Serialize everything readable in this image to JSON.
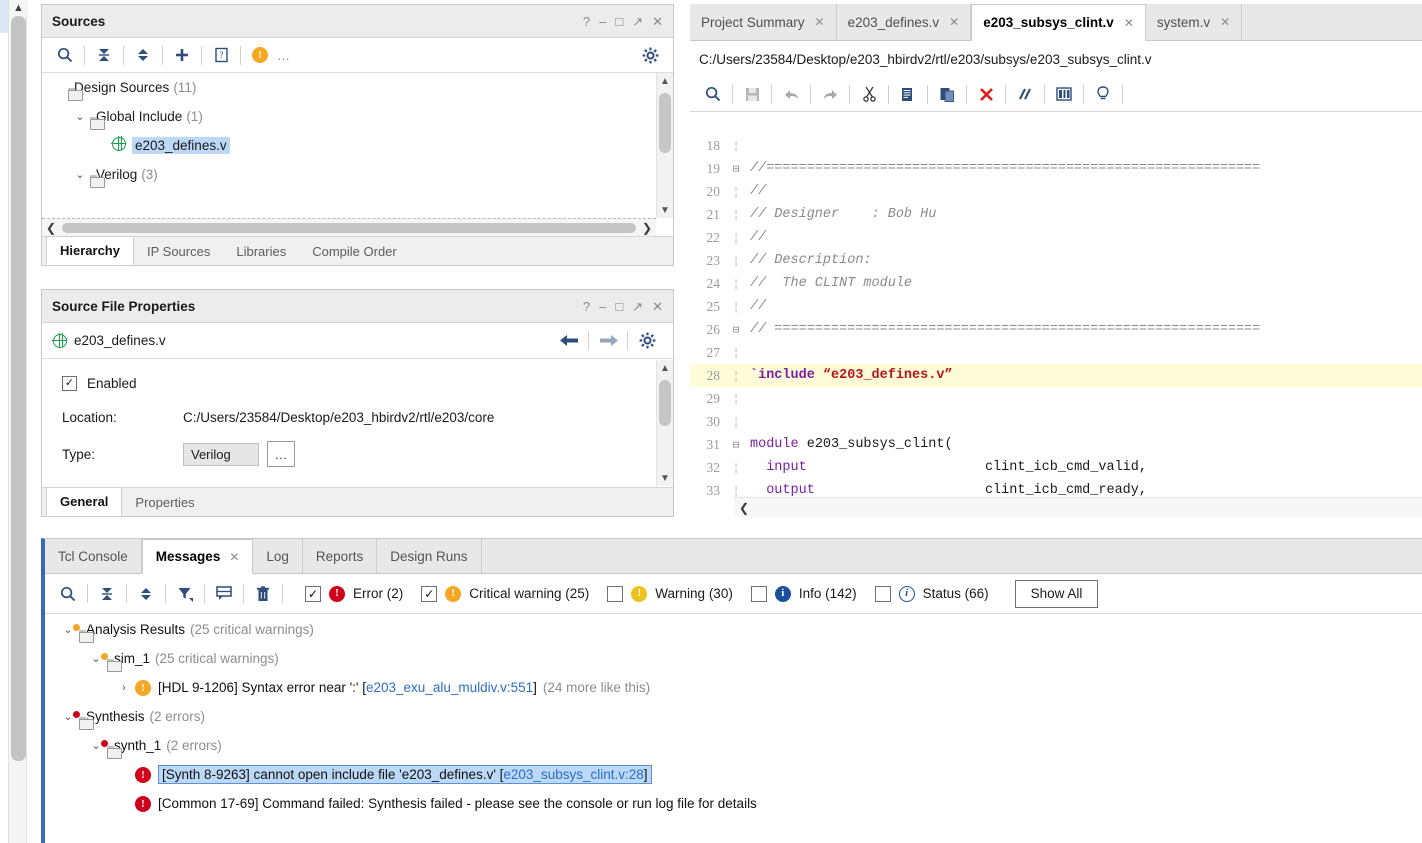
{
  "sources_panel": {
    "title": "Sources",
    "window_buttons": [
      "?",
      "–",
      "□",
      "↗",
      "✕"
    ],
    "toolbar_icons": [
      "search-icon",
      "collapse-all-icon",
      "expand-all-icon",
      "add-sources-icon",
      "report-icon",
      "warning-icon",
      "more-icon",
      "settings-gear-icon"
    ],
    "more_label": "…",
    "tree": [
      {
        "label": "Design Sources",
        "count": "(11)",
        "indent": 0,
        "twisty": "",
        "icon": "folder-icon",
        "selected": false
      },
      {
        "label": "Global Include",
        "count": "(1)",
        "indent": 1,
        "twisty": "⌄",
        "icon": "folder-icon",
        "selected": false
      },
      {
        "label": "e203_defines.v",
        "count": "",
        "indent": 2,
        "twisty": "",
        "icon": "globe-icon",
        "selected": true
      },
      {
        "label": "Verilog",
        "count": "(3)",
        "indent": 1,
        "twisty": "⌄",
        "icon": "folder-icon",
        "selected": false
      }
    ],
    "bottom_tabs": [
      {
        "label": "Hierarchy",
        "active": true
      },
      {
        "label": "IP Sources",
        "active": false
      },
      {
        "label": "Libraries",
        "active": false
      },
      {
        "label": "Compile Order",
        "active": false
      }
    ]
  },
  "source_file_properties": {
    "title": "Source File Properties",
    "window_buttons": [
      "?",
      "–",
      "□",
      "↗",
      "✕"
    ],
    "file_name": "e203_defines.v",
    "nav_icons": [
      "back-arrow-icon",
      "forward-arrow-icon",
      "settings-gear-icon"
    ],
    "enabled_label": "Enabled",
    "enabled_checked": true,
    "location_label": "Location:",
    "location_value": "C:/Users/23584/Desktop/e203_hbirdv2/rtl/e203/core",
    "type_label": "Type:",
    "type_value": "Verilog",
    "type_browse_label": "…",
    "bottom_tabs": [
      {
        "label": "General",
        "active": true
      },
      {
        "label": "Properties",
        "active": false
      }
    ]
  },
  "editor": {
    "tabs": [
      {
        "label": "Project Summary",
        "active": false,
        "close": "✕"
      },
      {
        "label": "e203_defines.v",
        "active": false,
        "close": "✕"
      },
      {
        "label": "e203_subsys_clint.v",
        "active": true,
        "close": "✕"
      },
      {
        "label": "system.v",
        "active": false,
        "close": "✕"
      }
    ],
    "file_path": "C:/Users/23584/Desktop/e203_hbirdv2/rtl/e203/subsys/e203_subsys_clint.v",
    "toolbar_icons": [
      "search-icon",
      "save-icon",
      "undo-icon",
      "redo-icon",
      "cut-icon",
      "copy-icon",
      "paste-icon",
      "delete-icon",
      "comment-icon",
      "columns-icon",
      "bulb-icon"
    ],
    "lines": [
      {
        "num": "18",
        "fold": "",
        "tokens": []
      },
      {
        "num": "19",
        "fold": "⊟",
        "tokens": [
          {
            "t": "//=============================================================",
            "c": "c-cmt"
          }
        ]
      },
      {
        "num": "20",
        "fold": "",
        "tokens": [
          {
            "t": "//",
            "c": "c-cmt"
          }
        ]
      },
      {
        "num": "21",
        "fold": "",
        "tokens": [
          {
            "t": "// Designer    : Bob Hu",
            "c": "c-cmt"
          }
        ]
      },
      {
        "num": "22",
        "fold": "",
        "tokens": [
          {
            "t": "//",
            "c": "c-cmt"
          }
        ]
      },
      {
        "num": "23",
        "fold": "",
        "tokens": [
          {
            "t": "// Description:",
            "c": "c-cmt"
          }
        ]
      },
      {
        "num": "24",
        "fold": "",
        "tokens": [
          {
            "t": "//  The CLINT module",
            "c": "c-cmt"
          }
        ]
      },
      {
        "num": "25",
        "fold": "",
        "tokens": [
          {
            "t": "//",
            "c": "c-cmt"
          }
        ]
      },
      {
        "num": "26",
        "fold": "⊟",
        "tokens": [
          {
            "t": "// ============================================================",
            "c": "c-cmt"
          }
        ]
      },
      {
        "num": "27",
        "fold": "",
        "tokens": []
      },
      {
        "num": "28",
        "fold": "",
        "highlight": true,
        "tokens": [
          {
            "t": "`include ",
            "c": "c-kw"
          },
          {
            "t": "“e203_defines.v”",
            "c": "c-str"
          }
        ]
      },
      {
        "num": "29",
        "fold": "",
        "tokens": []
      },
      {
        "num": "30",
        "fold": "",
        "tokens": []
      },
      {
        "num": "31",
        "fold": "⊟",
        "tokens": [
          {
            "t": "module ",
            "c": "c-kw2"
          },
          {
            "t": "e203_subsys_clint(",
            "c": "c-plain"
          }
        ]
      },
      {
        "num": "32",
        "fold": "",
        "tokens": [
          {
            "t": "  input                      ",
            "c": "c-kw2"
          },
          {
            "t": "clint_icb_cmd_valid,",
            "c": "c-plain"
          }
        ]
      },
      {
        "num": "33",
        "fold": "",
        "tokens": [
          {
            "t": "  output                     ",
            "c": "c-kw2"
          },
          {
            "t": "clint_icb_cmd_ready,",
            "c": "c-plain"
          }
        ]
      }
    ]
  },
  "messages_panel": {
    "tabs": [
      {
        "label": "Tcl Console",
        "active": false,
        "close": ""
      },
      {
        "label": "Messages",
        "active": true,
        "close": "✕"
      },
      {
        "label": "Log",
        "active": false,
        "close": ""
      },
      {
        "label": "Reports",
        "active": false,
        "close": ""
      },
      {
        "label": "Design Runs",
        "active": false,
        "close": ""
      }
    ],
    "toolbar_icons": [
      "search-icon",
      "collapse-all-icon",
      "expand-all-icon",
      "filter-icon",
      "chat-icon",
      "trash-icon"
    ],
    "filters": [
      {
        "label": "Error (2)",
        "checked": true,
        "severity": "error"
      },
      {
        "label": "Critical warning (25)",
        "checked": true,
        "severity": "critical"
      },
      {
        "label": "Warning (30)",
        "checked": false,
        "severity": "warning"
      },
      {
        "label": "Info (142)",
        "checked": false,
        "severity": "info"
      },
      {
        "label": "Status (66)",
        "checked": false,
        "severity": "status"
      }
    ],
    "show_all_label": "Show All",
    "tree": [
      {
        "indent": 0,
        "twisty": "⌄",
        "icon": "folder-orange-icon",
        "label": "Analysis Results",
        "dim": "(25 critical warnings)",
        "severity": "",
        "link": "",
        "tail": "",
        "selected": false
      },
      {
        "indent": 1,
        "twisty": "⌄",
        "icon": "folder-orange-icon",
        "label": "sim_1",
        "dim": "(25 critical warnings)",
        "severity": "",
        "link": "",
        "tail": "",
        "selected": false
      },
      {
        "indent": 2,
        "twisty": "›",
        "icon": "",
        "severity": "critical",
        "label": "[HDL 9-1206] Syntax error near ':' [",
        "dim": "",
        "link": "e203_exu_alu_muldiv.v:551",
        "tail": "]",
        "trailing_dim": "(24 more like this)",
        "selected": false
      },
      {
        "indent": 0,
        "twisty": "⌄",
        "icon": "folder-red-icon",
        "label": "Synthesis",
        "dim": "(2 errors)",
        "severity": "",
        "link": "",
        "tail": "",
        "selected": false
      },
      {
        "indent": 1,
        "twisty": "⌄",
        "icon": "folder-red-icon",
        "label": "synth_1",
        "dim": "(2 errors)",
        "severity": "",
        "link": "",
        "tail": "",
        "selected": false
      },
      {
        "indent": 2,
        "twisty": "",
        "icon": "",
        "severity": "error",
        "label": "[Synth 8-9263] cannot open include file 'e203_defines.v' [",
        "dim": "",
        "link": "e203_subsys_clint.v:28",
        "tail": "]",
        "trailing_dim": "",
        "selected": true
      },
      {
        "indent": 2,
        "twisty": "",
        "icon": "",
        "severity": "error",
        "label": "[Common 17-69] Command failed: Synthesis failed - please see the console or run log file for details",
        "dim": "",
        "link": "",
        "tail": "",
        "trailing_dim": "",
        "selected": false
      }
    ]
  },
  "colors": {
    "accent_blue": "#3b68b8",
    "error_red": "#d0021b",
    "critical_orange": "#f5a623",
    "warning_yellow": "#edc21c",
    "info_blue": "#1b4f9c",
    "selection_blue": "#bcd8f7",
    "link_blue": "#2b6fc4",
    "highlight_yellow": "#fdfbd8"
  }
}
